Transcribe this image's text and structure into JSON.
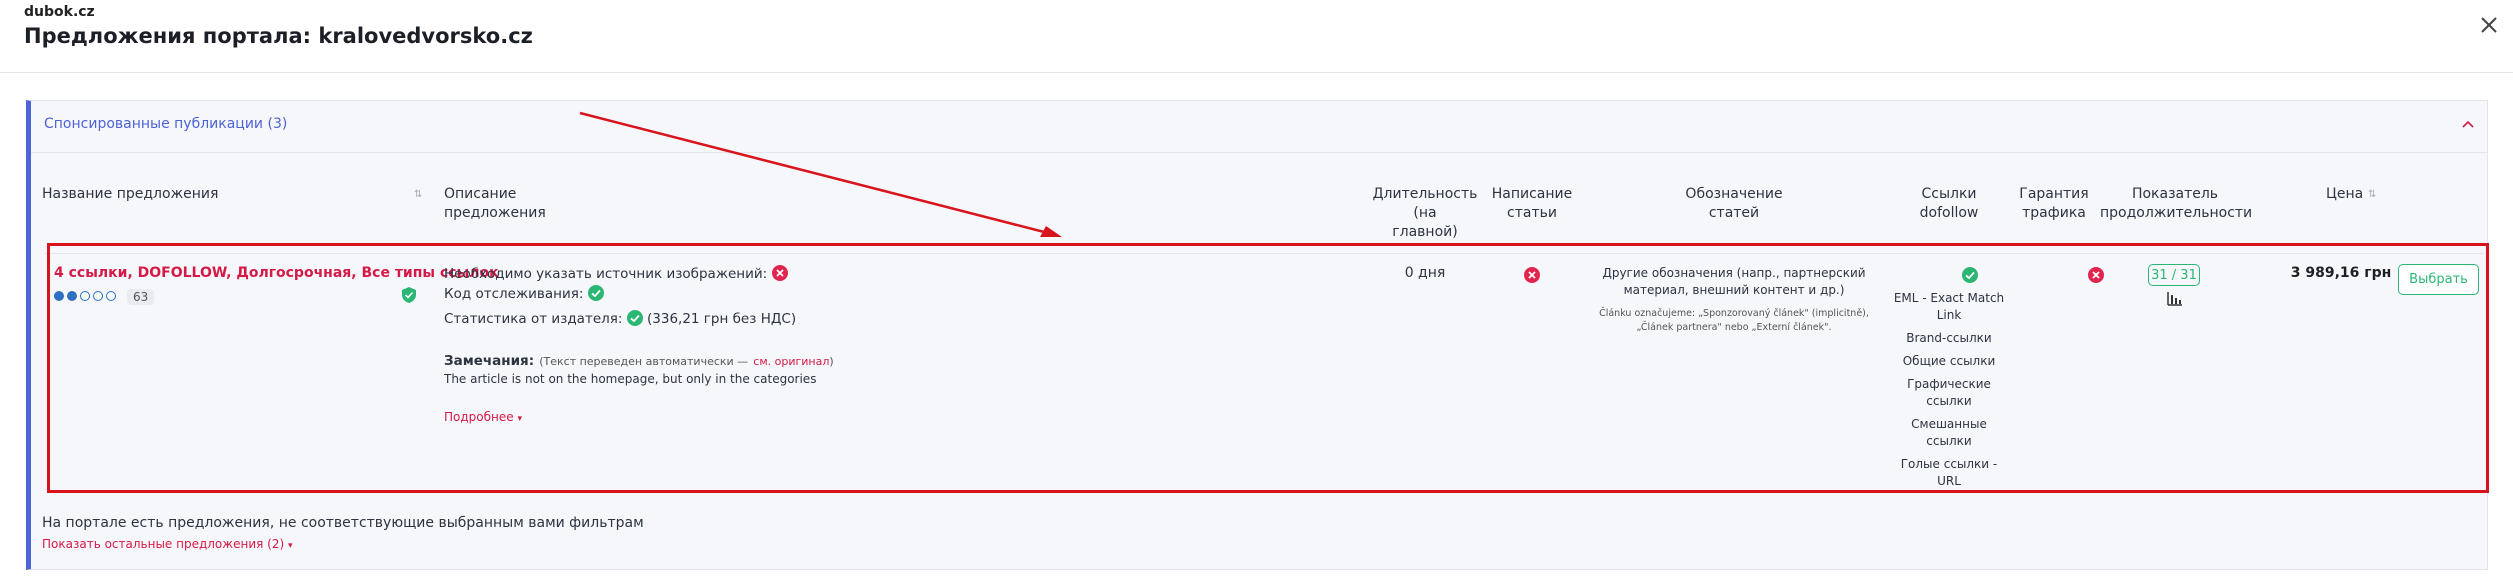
{
  "header": {
    "site": "dubok.cz",
    "title": "Предложения портала: kralovedvorsko.cz"
  },
  "section": {
    "title": "Спонсированные публикации (3)"
  },
  "columns": {
    "name": "Название предложения",
    "description_l1": "Описание",
    "description_l2": "предложения",
    "duration_l1": "Длительность",
    "duration_l2": "(на",
    "duration_l3": "главной)",
    "writing_l1": "Написание",
    "writing_l2": "статьи",
    "labeling_l1": "Обозначение",
    "labeling_l2": "статей",
    "links_l1": "Ссылки",
    "links_l2": "dofollow",
    "traffic_l1": "Гарантия",
    "traffic_l2": "трафика",
    "longevity_l1": "Показатель",
    "longevity_l2": "продолжительности",
    "price": "Цена",
    "sort_symbol": "⇅"
  },
  "offer": {
    "name": "4 ссылки, DOFOLLOW, Долгосрочная, Все типы ссылок",
    "rating_filled": 2,
    "rating_total": 5,
    "score": "63",
    "desc_image_source": "Необходимо указать источник изображений:",
    "desc_tracking": "Код отслеживания:",
    "desc_stats": "Статистика от издателя:",
    "desc_stats_value": "(336,21 грн без НДС)",
    "notes_label": "Замечания:",
    "notes_hint": "(Текст переведен автоматически —",
    "notes_hint_link": "см. оригинал",
    "notes_hint_end": ")",
    "notes_text": "The article is not on the homepage, but only in the categories",
    "more_link": "Подробнее",
    "more_symbol": "▾",
    "duration": "0 дня",
    "labeling_main_l1": "Другие обозначения (напр., партнерский",
    "labeling_main_l2": "материал, внешний контент и др.)",
    "labeling_note_l1": "Článku označujeme: „Sponzorovaný článek\" (implicitně),",
    "labeling_note_l2": "„Článek partnera\" nebo „Externí článek\".",
    "link_types": [
      "EML - Exact Match",
      "Link",
      "Brand-ссылки",
      "Общие ссылки",
      "Графические",
      "ссылки",
      "Смешанные",
      "ссылки",
      "Голые ссылки -",
      "URL"
    ],
    "longevity": "31 / 31",
    "price": "3 989,16 грн",
    "choose_label": "Выбрать"
  },
  "footer": {
    "text": "На портале есть предложения, не соответствующие выбранным вами фильтрам",
    "show_more": "Показать остальные предложения (2)",
    "show_more_symbol": "▾"
  },
  "colors": {
    "accent_blue": "#4d63d6",
    "brand_red": "#d51a47",
    "success_green": "#2bb673",
    "annotation_red": "#d8141e"
  }
}
